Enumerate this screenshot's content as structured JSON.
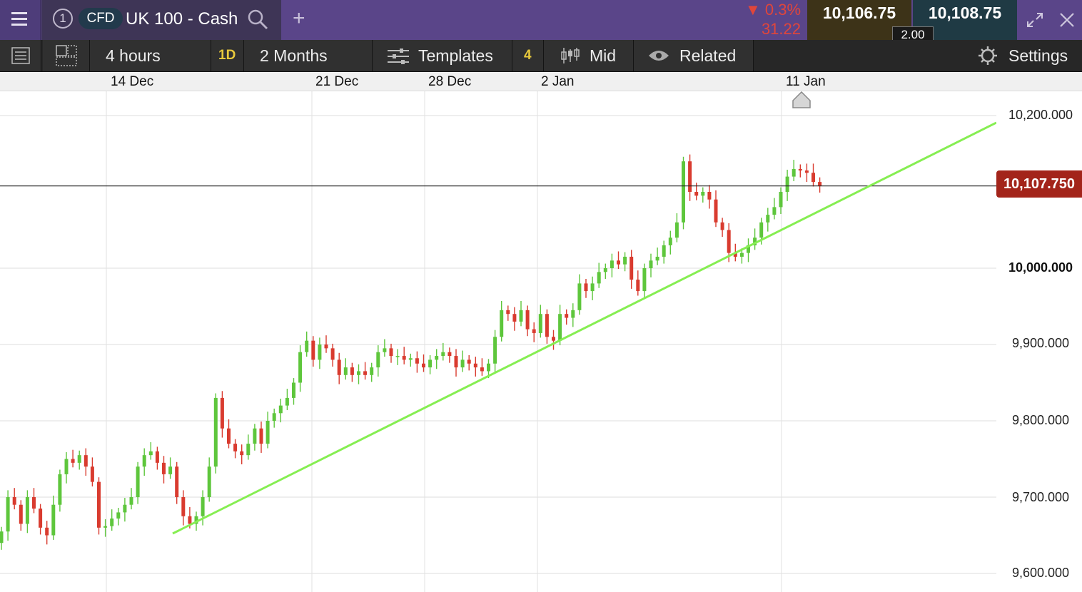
{
  "tab": {
    "number": "1",
    "type": "CFD",
    "instrument": "UK 100 - Cash"
  },
  "quote": {
    "change_pct": "▼ 0.3%",
    "change_abs": "31.22",
    "sell": "10,106.75",
    "buy": "10,108.75",
    "spread": "2.00"
  },
  "toolbar": {
    "timeframe": "4 hours",
    "period_badge": "1D",
    "period": "2 Months",
    "templates": "Templates",
    "templates_count": "4",
    "price_type": "Mid",
    "related": "Related",
    "settings": "Settings"
  },
  "icons": [
    "menu-icon",
    "search-icon",
    "add-icon",
    "expand-icon",
    "close-icon",
    "list-icon",
    "layout-icon",
    "templates-icon",
    "candlestick-icon",
    "eye-icon",
    "gear-icon",
    "home-marker-icon"
  ],
  "colors": {
    "up": "#5ec63c",
    "down": "#d93b2f",
    "trendline": "#86ee52",
    "current_price": "#a3241a",
    "topbar": "#5a4589"
  },
  "chart_data": {
    "type": "candlestick",
    "x_tick_labels": [
      "14 Dec",
      "21 Dec",
      "28 Dec",
      "2 Jan",
      "11 Jan"
    ],
    "y_tick_labels": [
      "10,200.000",
      "10,000.000",
      "9,900.000",
      "9,800.000",
      "9,700.000",
      "9,600.000"
    ],
    "y_bold_tick": "10,000.000",
    "ylim": [
      9590,
      10230
    ],
    "current_price": 10107.75,
    "current_price_label": "10,107.750",
    "grid": true,
    "close": [
      9655,
      9700,
      9690,
      9665,
      9700,
      9685,
      9660,
      9650,
      9690,
      9730,
      9750,
      9745,
      9755,
      9740,
      9720,
      9660,
      9662,
      9672,
      9680,
      9690,
      9700,
      9740,
      9755,
      9760,
      9745,
      9730,
      9740,
      9700,
      9675,
      9665,
      9675,
      9700,
      9740,
      9830,
      9790,
      9770,
      9760,
      9755,
      9770,
      9790,
      9770,
      9800,
      9810,
      9820,
      9830,
      9850,
      9890,
      9905,
      9880,
      9900,
      9895,
      9880,
      9860,
      9870,
      9860,
      9865,
      9860,
      9870,
      9890,
      9895,
      9885,
      9885,
      9880,
      9882,
      9875,
      9870,
      9880,
      9885,
      9890,
      9885,
      9870,
      9880,
      9875,
      9870,
      9865,
      9875,
      9910,
      9945,
      9940,
      9930,
      9945,
      9920,
      9915,
      9940,
      9910,
      9905,
      9940,
      9935,
      9945,
      9980,
      9970,
      9980,
      9995,
      10000,
      10010,
      10005,
      10015,
      9985,
      9970,
      10000,
      10010,
      10015,
      10030,
      10040,
      10060,
      10140,
      10100,
      10095,
      10100,
      10090,
      10060,
      10050,
      10020,
      10015,
      10020,
      10030,
      10040,
      10060,
      10070,
      10080,
      10100,
      10120,
      10130,
      10128,
      10125,
      10113,
      10108
    ],
    "start_open": 9640
  }
}
